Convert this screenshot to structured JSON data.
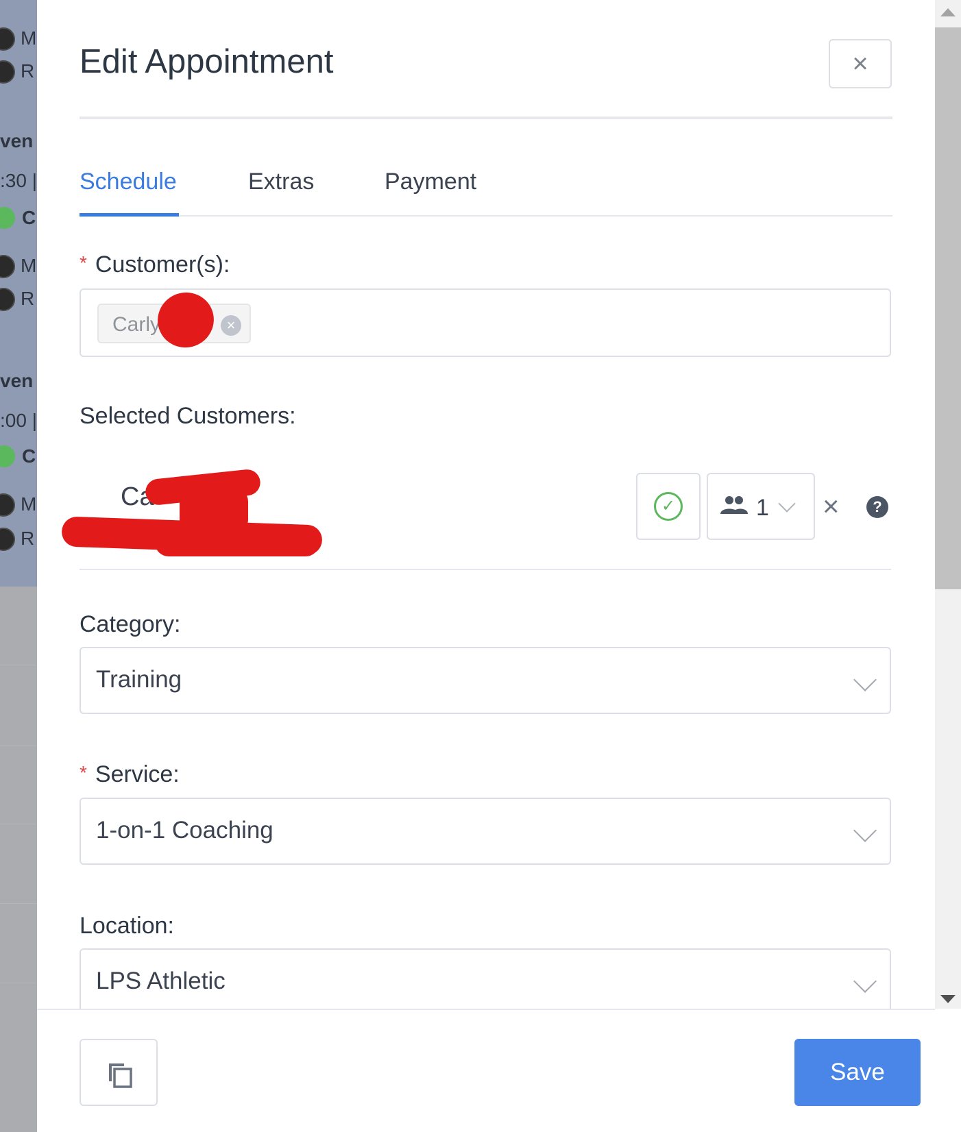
{
  "background": {
    "rows": [
      {
        "text": "M",
        "type": "avatar"
      },
      {
        "text": "R",
        "type": "avatar"
      },
      {
        "text": "ven",
        "type": "bold"
      },
      {
        "text": ":30 |",
        "type": "time"
      },
      {
        "text": "C",
        "type": "check"
      },
      {
        "text": "M",
        "type": "avatar"
      },
      {
        "text": "R",
        "type": "avatar"
      },
      {
        "text": "ven",
        "type": "bold"
      },
      {
        "text": ":00 |",
        "type": "time"
      },
      {
        "text": "C",
        "type": "check"
      },
      {
        "text": "M",
        "type": "avatar"
      },
      {
        "text": "R",
        "type": "avatar"
      }
    ]
  },
  "dialog": {
    "title": "Edit Appointment",
    "close_label": "×"
  },
  "tabs": [
    {
      "label": "Schedule",
      "active": true
    },
    {
      "label": "Extras",
      "active": false
    },
    {
      "label": "Payment",
      "active": false
    }
  ],
  "customers": {
    "required_mark": "*",
    "label": "Customer(s):",
    "tag_text": "Carly",
    "tag_remove": "×"
  },
  "selected_customers": {
    "label": "Selected Customers:",
    "name_visible": "Ca",
    "status_check": "✓",
    "persons_count": "1",
    "remove_label": "×",
    "help_label": "?"
  },
  "category": {
    "label": "Category:",
    "value": "Training"
  },
  "service": {
    "required_mark": "*",
    "label": "Service:",
    "value": "1-on-1 Coaching"
  },
  "location": {
    "label": "Location:",
    "value": "LPS Athletic"
  },
  "footer": {
    "save_label": "Save"
  },
  "colors": {
    "accent": "#3a7be0",
    "save_button": "#4a86e8",
    "required": "#e04848",
    "success": "#5cb85c",
    "redaction": "#e31a1a"
  },
  "icons": {
    "close": "close-icon",
    "tag_remove": "tag-remove-icon",
    "status": "check-circle-icon",
    "persons": "people-icon",
    "remove": "remove-icon",
    "help": "help-icon",
    "dropdown": "chevron-down-icon",
    "duplicate": "copy-icon"
  }
}
